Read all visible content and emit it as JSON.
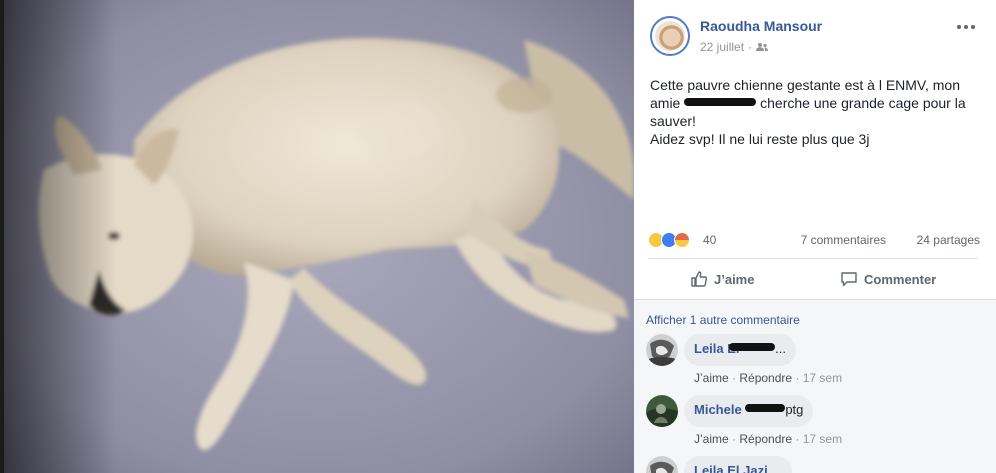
{
  "post": {
    "author_name": "Raoudha Mansour",
    "date": "22 juillet",
    "meta_separator": "·",
    "privacy_icon": "friends-icon",
    "text_line_1": "Cette pauvre chienne gestante est à l ENMV, mon",
    "text_line_2_a": "amie",
    "text_line_2_b": "cherche une grande cage pour la",
    "text_line_3": "sauver!",
    "text_line_4": "Aidez svp! Il ne lui reste plus que 3j"
  },
  "reactions": {
    "icons": [
      "sad-reaction-icon",
      "like-reaction-icon",
      "angry-reaction-icon"
    ],
    "count": "40",
    "comments": "7 commentaires",
    "shares": "24 partages"
  },
  "actions": {
    "like_label": "J’aime",
    "comment_label": "Commenter"
  },
  "comments_section": {
    "view_more": "Afficher 1 autre commentaire",
    "items": [
      {
        "name": "Leila El",
        "text": "...",
        "like": "J’aime",
        "reply": "Répondre",
        "time": "17 sem"
      },
      {
        "name": "Michele",
        "text": "ptg",
        "like": "J’aime",
        "reply": "Répondre",
        "time": "17 sem"
      },
      {
        "name": "Leila El Jazi",
        "text": "..."
      }
    ]
  },
  "colors": {
    "link_blue": "#385898",
    "avatar_ring": "#4f7dc6",
    "muted_text": "#90949c",
    "comment_bubble": "#e9ebee"
  }
}
